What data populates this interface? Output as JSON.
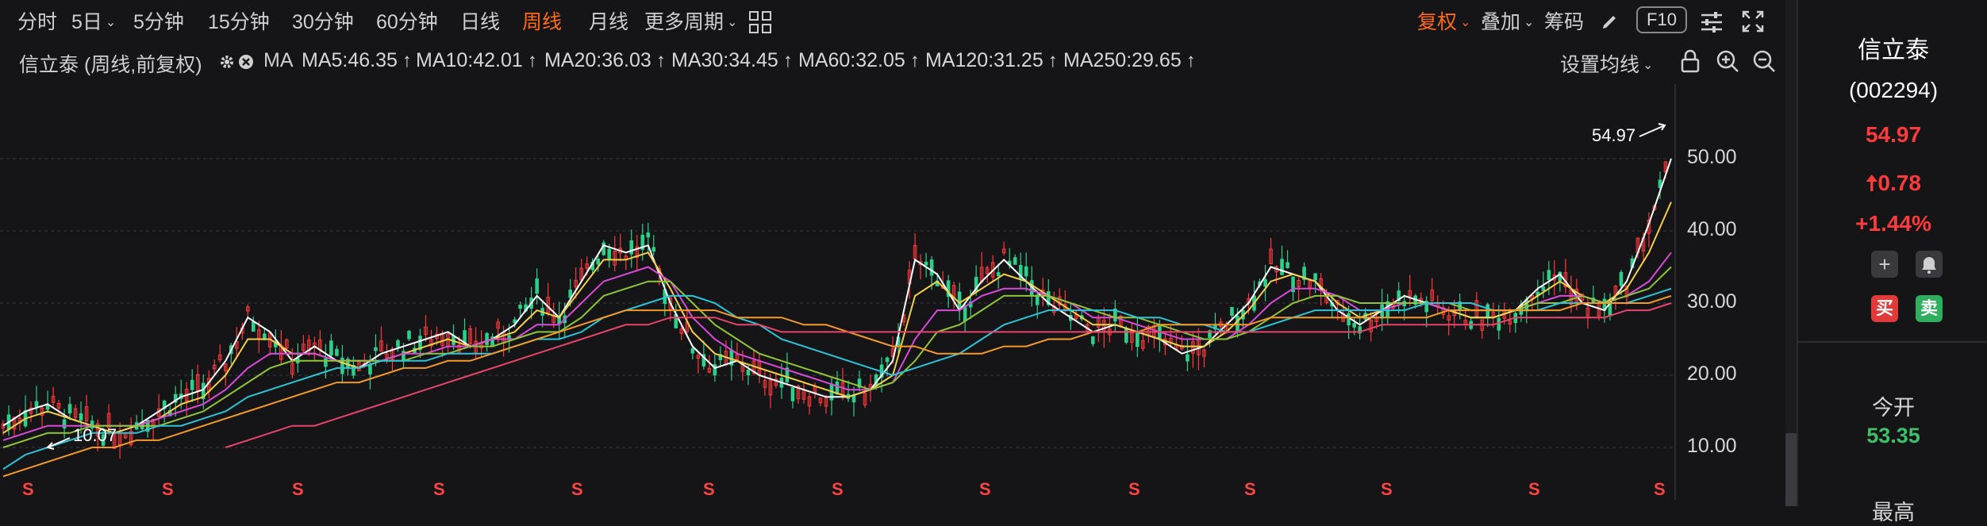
{
  "toolbar": {
    "periods": [
      "分时",
      "5日",
      "5分钟",
      "15分钟",
      "30分钟",
      "60分钟",
      "日线",
      "周线",
      "月线",
      "更多周期"
    ],
    "active_period": "周线",
    "fuquan": "复权",
    "overlay": "叠加",
    "chips": "筹码",
    "f10": "F10"
  },
  "ma_row": {
    "title": "信立泰 (周线,前复权)",
    "ma_text": "MA",
    "items": [
      {
        "label": "MA5:46.35",
        "color": "#ffffff"
      },
      {
        "label": "MA10:42.01",
        "color": "#f2d04b"
      },
      {
        "label": "MA20:36.03",
        "color": "#d84bd8"
      },
      {
        "label": "MA30:34.45",
        "color": "#8fc43c"
      },
      {
        "label": "MA60:32.05",
        "color": "#2ec4d6"
      },
      {
        "label": "MA120:31.25",
        "color": "#f39a2b"
      },
      {
        "label": "MA250:29.65",
        "color": "#e8456b"
      }
    ],
    "arrow": "↑",
    "setting": "设置均线"
  },
  "chart_data": {
    "type": "line",
    "y_ticks": [
      "50.00",
      "40.00",
      "30.00",
      "20.00",
      "10.00"
    ],
    "ylim": [
      6,
      56
    ],
    "high_annotation": "54.97",
    "low_annotation": "10.07",
    "marker": "S",
    "series": [
      {
        "name": "MA5",
        "values": [
          13,
          15,
          16,
          14,
          13,
          12,
          13,
          15,
          17,
          18,
          22,
          28,
          26,
          22,
          24,
          22,
          21,
          23,
          24,
          25,
          26,
          24,
          25,
          27,
          31,
          28,
          33,
          38,
          37,
          38,
          30,
          24,
          21,
          22,
          20,
          19,
          18,
          17,
          17,
          18,
          22,
          36,
          34,
          29,
          33,
          36,
          33,
          30,
          28,
          26,
          27,
          26,
          25,
          23,
          24,
          27,
          30,
          35,
          34,
          33,
          29,
          27,
          29,
          31,
          30,
          29,
          28,
          28,
          29,
          32,
          34,
          30,
          29,
          33,
          41,
          50
        ]
      },
      {
        "name": "MA10",
        "values": [
          12,
          14,
          15,
          14,
          13,
          12,
          13,
          14,
          16,
          17,
          20,
          25,
          25,
          23,
          23,
          22,
          21,
          22,
          23,
          24,
          25,
          24,
          25,
          26,
          29,
          28,
          32,
          36,
          36,
          37,
          32,
          26,
          23,
          22,
          21,
          20,
          19,
          18,
          17,
          18,
          20,
          31,
          33,
          30,
          32,
          34,
          33,
          31,
          29,
          27,
          27,
          26,
          25,
          24,
          24,
          26,
          29,
          33,
          34,
          33,
          30,
          28,
          29,
          30,
          30,
          29,
          28,
          28,
          29,
          31,
          33,
          31,
          30,
          32,
          37,
          44
        ]
      },
      {
        "name": "MA20",
        "values": [
          11,
          12,
          13,
          13,
          13,
          13,
          13,
          14,
          15,
          16,
          18,
          21,
          23,
          23,
          23,
          22,
          22,
          22,
          23,
          23,
          24,
          24,
          25,
          25,
          27,
          27,
          30,
          33,
          34,
          35,
          33,
          28,
          25,
          23,
          22,
          21,
          20,
          19,
          18,
          18,
          19,
          25,
          29,
          29,
          31,
          32,
          32,
          31,
          30,
          28,
          28,
          27,
          26,
          25,
          25,
          25,
          27,
          30,
          32,
          32,
          31,
          29,
          29,
          30,
          30,
          29,
          29,
          29,
          29,
          30,
          31,
          31,
          30,
          31,
          33,
          37
        ]
      },
      {
        "name": "MA30",
        "values": [
          10,
          11,
          12,
          12,
          13,
          13,
          13,
          13,
          14,
          15,
          17,
          19,
          21,
          22,
          22,
          22,
          22,
          22,
          22,
          23,
          23,
          24,
          24,
          25,
          26,
          26,
          28,
          31,
          32,
          33,
          33,
          30,
          27,
          25,
          23,
          22,
          21,
          20,
          19,
          18,
          19,
          22,
          26,
          27,
          29,
          31,
          31,
          31,
          30,
          29,
          28,
          28,
          27,
          26,
          25,
          25,
          26,
          28,
          30,
          31,
          31,
          30,
          30,
          30,
          30,
          30,
          29,
          29,
          29,
          30,
          30,
          31,
          30,
          31,
          32,
          35
        ]
      },
      {
        "name": "MA60",
        "values": [
          7,
          9,
          10,
          11,
          12,
          12,
          12,
          13,
          13,
          14,
          15,
          17,
          18,
          19,
          20,
          21,
          21,
          22,
          22,
          22,
          23,
          23,
          23,
          24,
          25,
          25,
          26,
          28,
          29,
          30,
          31,
          31,
          30,
          28,
          27,
          25,
          24,
          23,
          22,
          21,
          20,
          21,
          22,
          23,
          25,
          27,
          28,
          29,
          29,
          29,
          29,
          28,
          28,
          27,
          27,
          26,
          26,
          27,
          28,
          29,
          29,
          29,
          29,
          29,
          30,
          30,
          30,
          29,
          29,
          29,
          30,
          30,
          30,
          30,
          31,
          32
        ]
      },
      {
        "name": "MA120",
        "values": [
          6,
          7,
          8,
          9,
          10,
          10,
          11,
          11,
          12,
          13,
          14,
          15,
          16,
          17,
          18,
          19,
          19,
          20,
          21,
          21,
          22,
          22,
          23,
          24,
          25,
          26,
          27,
          28,
          29,
          29,
          29,
          29,
          29,
          28,
          28,
          28,
          27,
          27,
          26,
          25,
          24,
          24,
          23,
          23,
          23,
          24,
          24,
          25,
          25,
          26,
          26,
          26,
          27,
          27,
          27,
          27,
          27,
          28,
          28,
          28,
          28,
          28,
          28,
          28,
          28,
          29,
          29,
          29,
          29,
          29,
          29,
          30,
          30,
          30,
          30,
          31
        ]
      },
      {
        "name": "MA250",
        "values": [
          null,
          null,
          null,
          null,
          null,
          null,
          null,
          null,
          null,
          null,
          10,
          11,
          12,
          13,
          13,
          14,
          15,
          16,
          17,
          18,
          19,
          20,
          21,
          22,
          23,
          24,
          25,
          26,
          27,
          27,
          28,
          28,
          28,
          27,
          27,
          26,
          26,
          26,
          26,
          26,
          26,
          26,
          26,
          26,
          26,
          26,
          26,
          26,
          26,
          26,
          26,
          26,
          26,
          26,
          26,
          26,
          26,
          26,
          26,
          26,
          26,
          26,
          27,
          27,
          27,
          27,
          27,
          27,
          28,
          28,
          28,
          28,
          28,
          29,
          29,
          30
        ]
      }
    ]
  },
  "side": {
    "name": "信立泰",
    "code": "(002294)",
    "price": "54.97",
    "change": "0.78",
    "change_arrow": "🠅",
    "pct": "+1.44%",
    "buy": "买",
    "sell": "卖",
    "open_label": "今开",
    "open_value": "53.35",
    "more_label": "最高",
    "up_color": "#ff3b3b",
    "down_color": "#3fbf6a"
  }
}
